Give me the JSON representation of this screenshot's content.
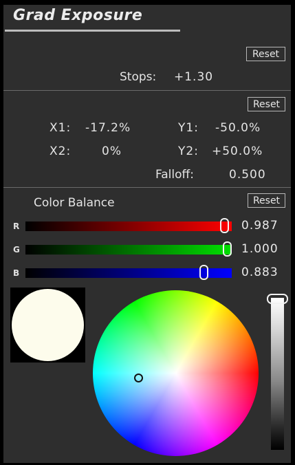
{
  "header": {
    "title": "Grad Exposure"
  },
  "stops": {
    "reset_label": "Reset",
    "label": "Stops:",
    "value": "+1.30"
  },
  "position": {
    "reset_label": "Reset",
    "x1_label": "X1:",
    "x1_value": "-17.2%",
    "y1_label": "Y1:",
    "y1_value": "-50.0%",
    "x2_label": "X2:",
    "x2_value": "0%",
    "y2_label": "Y2:",
    "y2_value": "+50.0%",
    "falloff_label": "Falloff:",
    "falloff_value": "0.500"
  },
  "color_balance": {
    "title": "Color Balance",
    "reset_label": "Reset",
    "channels": [
      {
        "label": "R",
        "value": "0.987",
        "fraction": 0.987,
        "color": "#ff0000"
      },
      {
        "label": "G",
        "value": "1.000",
        "fraction": 1.0,
        "color": "#00e000"
      },
      {
        "label": "B",
        "value": "0.883",
        "fraction": 0.883,
        "color": "#0000ff"
      }
    ],
    "swatch_color": "#fdfcec",
    "brightness_level": 1.0
  }
}
